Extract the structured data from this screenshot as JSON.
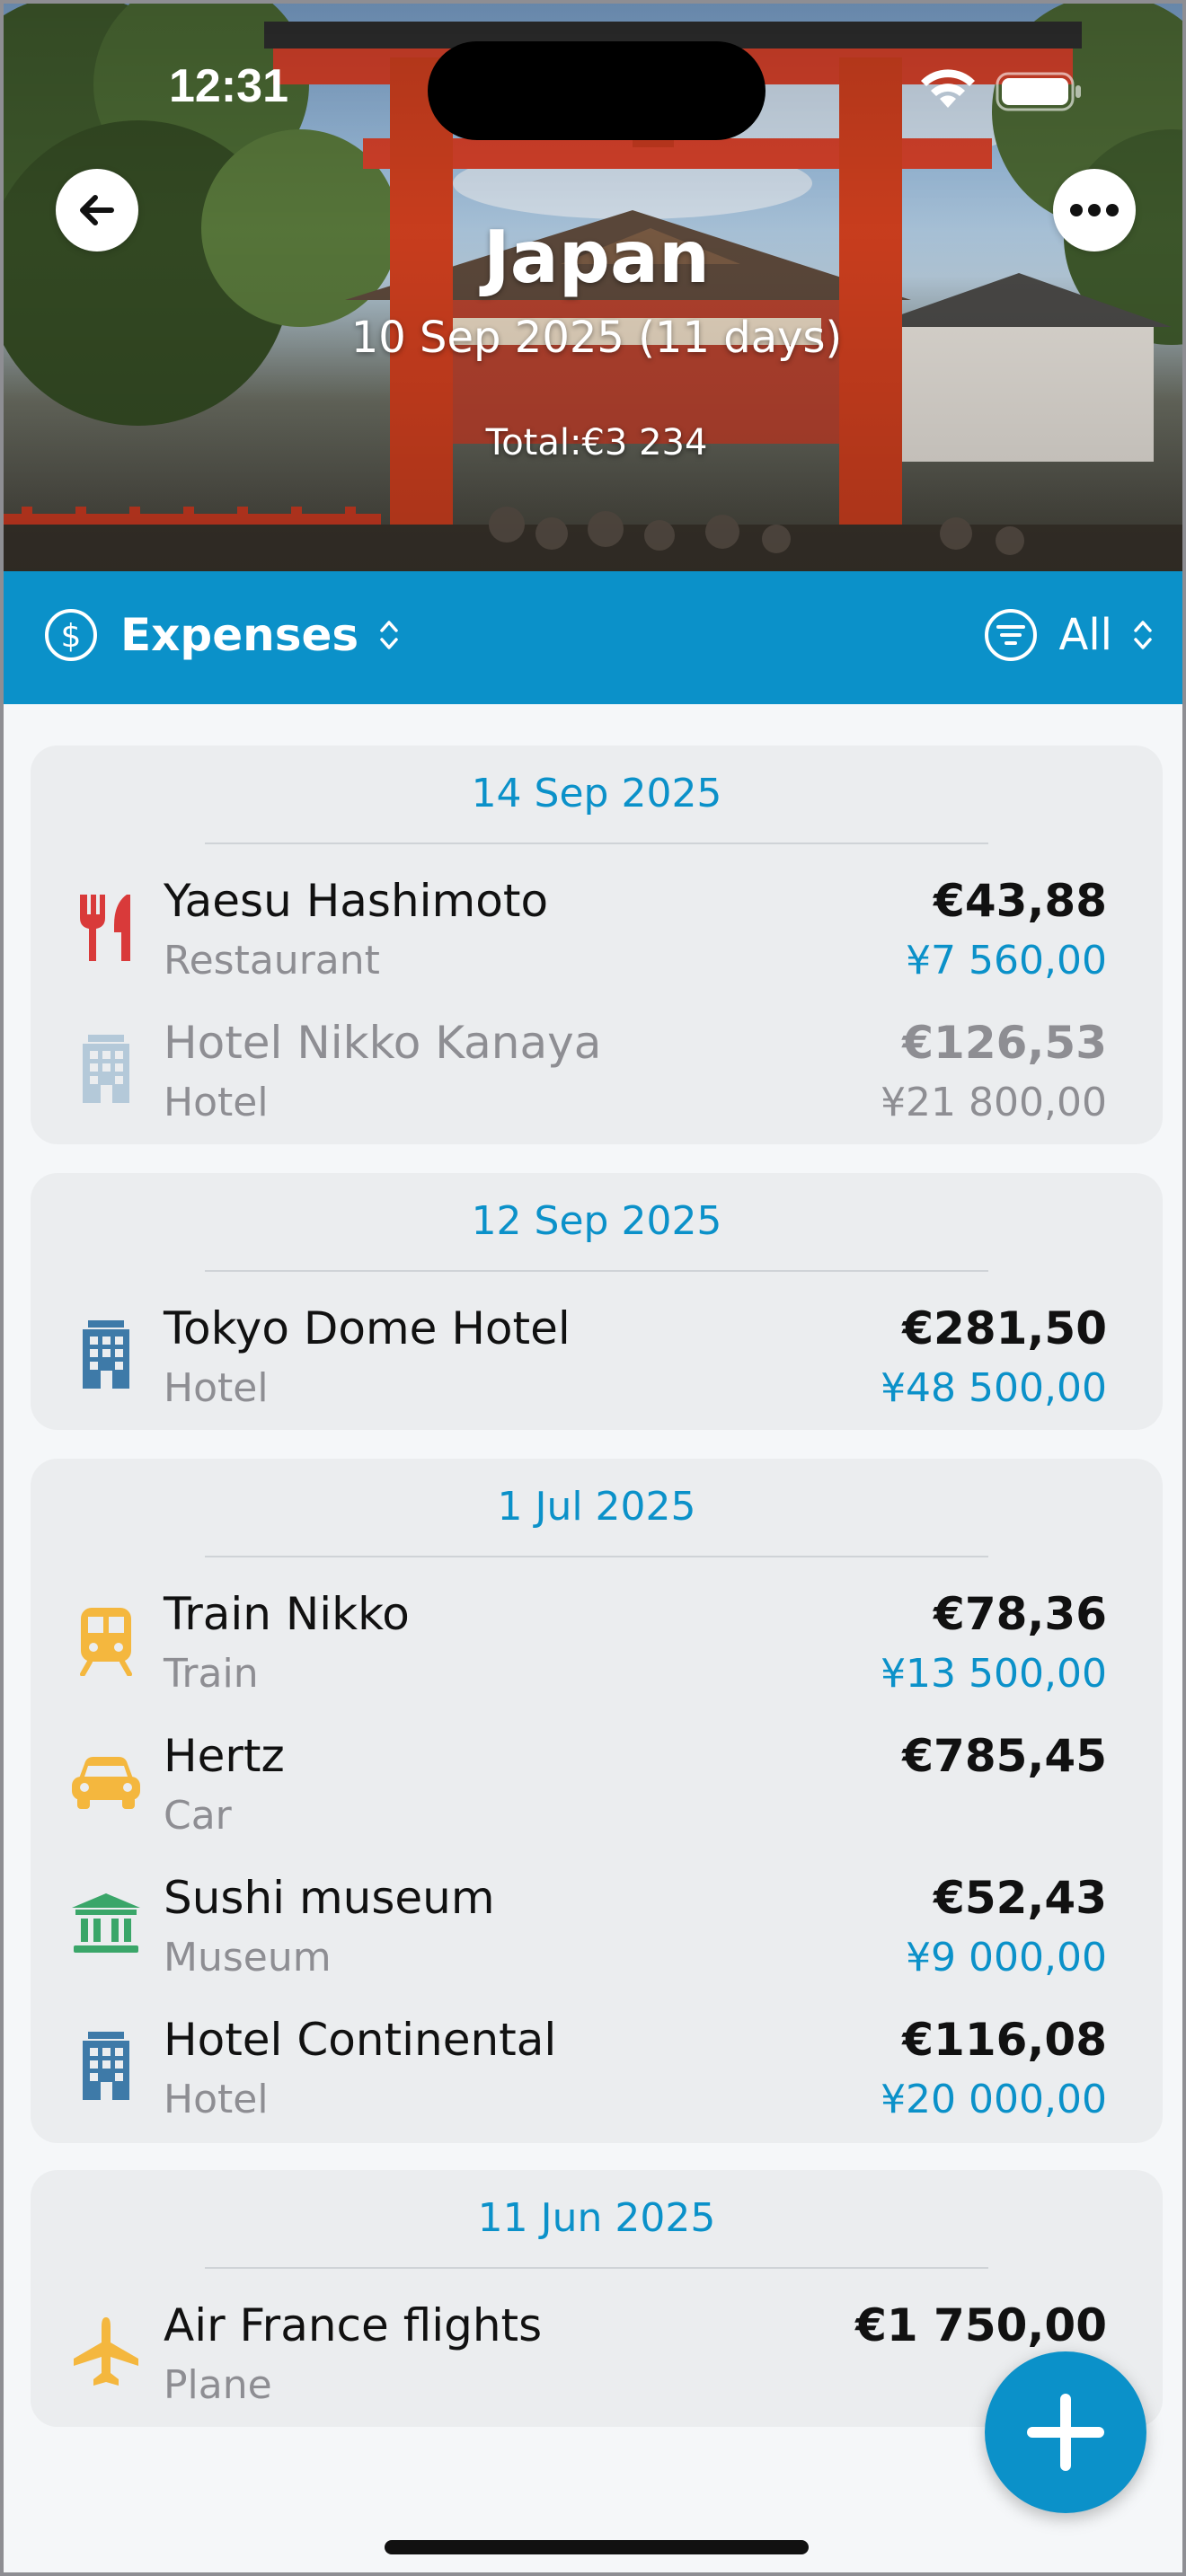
{
  "status_bar": {
    "time": "12:31"
  },
  "header": {
    "title": "Japan",
    "dates": "10 Sep 2025  (11 days)",
    "total": "Total:€3 234"
  },
  "toolbar": {
    "section_label": "Expenses",
    "filter_label": "All"
  },
  "groups": [
    {
      "date": "14 Sep 2025",
      "items": [
        {
          "name": "Yaesu Hashimoto",
          "category": "Restaurant",
          "amount_eur": "€43,88",
          "amount_local": "¥7 560,00",
          "icon": "restaurant-icon",
          "color": "#d93a3a"
        },
        {
          "name": "Hotel Nikko Kanaya",
          "category": "Hotel",
          "amount_eur": "€126,53",
          "amount_local": "¥21 800,00",
          "icon": "hotel-icon",
          "color": "#b4c9d9"
        }
      ]
    },
    {
      "date": "12 Sep 2025",
      "items": [
        {
          "name": "Tokyo Dome Hotel",
          "category": "Hotel",
          "amount_eur": "€281,50",
          "amount_local": "¥48 500,00",
          "icon": "hotel-icon",
          "color": "#3e7aa8"
        }
      ]
    },
    {
      "date": "1 Jul 2025",
      "items": [
        {
          "name": "Train Nikko",
          "category": "Train",
          "amount_eur": "€78,36",
          "amount_local": "¥13 500,00",
          "icon": "train-icon",
          "color": "#f4b73e"
        },
        {
          "name": "Hertz",
          "category": "Car",
          "amount_eur": "€785,45",
          "amount_local": "",
          "icon": "car-icon",
          "color": "#f4b73e"
        },
        {
          "name": "Sushi museum",
          "category": "Museum",
          "amount_eur": "€52,43",
          "amount_local": "¥9 000,00",
          "icon": "museum-icon",
          "color": "#3aa669"
        },
        {
          "name": "Hotel Continental",
          "category": "Hotel",
          "amount_eur": "€116,08",
          "amount_local": "¥20 000,00",
          "icon": "hotel-icon",
          "color": "#3e7aa8"
        }
      ]
    },
    {
      "date": "11 Jun 2025",
      "items": [
        {
          "name": "Air France flights",
          "category": "Plane",
          "amount_eur": "€1 750,00",
          "amount_local": "",
          "icon": "plane-icon",
          "color": "#f4b73e"
        }
      ]
    }
  ],
  "colors": {
    "accent": "#0b91c9",
    "card": "#ebedef",
    "background": "#f5f7f9"
  }
}
